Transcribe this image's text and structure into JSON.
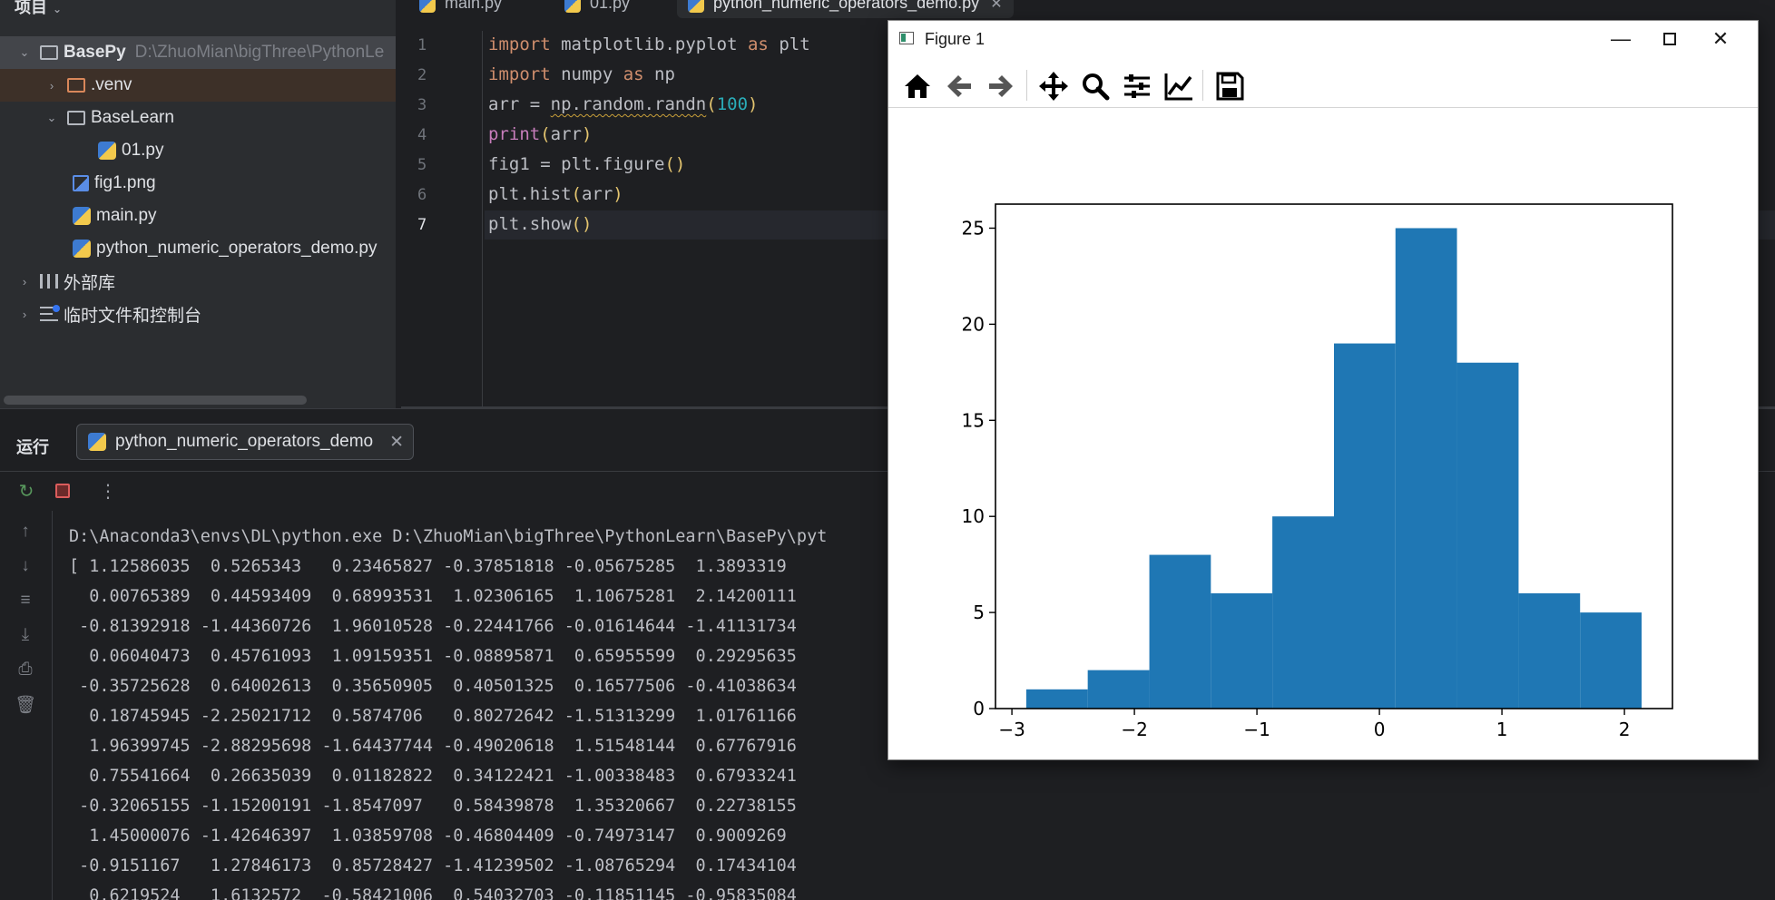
{
  "project": {
    "header": "项目",
    "items": [
      {
        "label": "BasePy",
        "path": "D:\\ZhuoMian\\bigThree\\PythonLe"
      },
      {
        "label": ".venv"
      },
      {
        "label": "BaseLearn"
      },
      {
        "label": "01.py"
      },
      {
        "label": "fig1.png"
      },
      {
        "label": "main.py"
      },
      {
        "label": "python_numeric_operators_demo.py"
      },
      {
        "label": "外部库"
      },
      {
        "label": "临时文件和控制台"
      }
    ]
  },
  "editor": {
    "tabs": [
      "main.py",
      "01.py",
      "python_numeric_operators_demo.py"
    ],
    "active_tab": 2,
    "line_numbers": [
      "1",
      "2",
      "3",
      "4",
      "5",
      "6",
      "7"
    ],
    "current_line": 7,
    "lines": [
      [
        {
          "t": "import",
          "c": "kw"
        },
        {
          "t": " matplotlib.pyplot ",
          "c": ""
        },
        {
          "t": "as",
          "c": "kw"
        },
        {
          "t": " plt",
          "c": ""
        }
      ],
      [
        {
          "t": "import",
          "c": "kw"
        },
        {
          "t": " numpy ",
          "c": ""
        },
        {
          "t": "as",
          "c": "kw"
        },
        {
          "t": " np",
          "c": ""
        }
      ],
      [
        {
          "t": "arr = ",
          "c": ""
        },
        {
          "t": "np.random.randn",
          "c": "squig"
        },
        {
          "t": "(",
          "c": "par"
        },
        {
          "t": "100",
          "c": "num"
        },
        {
          "t": ")",
          "c": "par"
        }
      ],
      [
        {
          "t": "print",
          "c": "fn"
        },
        {
          "t": "(",
          "c": "par"
        },
        {
          "t": "arr",
          "c": ""
        },
        {
          "t": ")",
          "c": "par"
        }
      ],
      [
        {
          "t": "fig1 = plt.figure",
          "c": ""
        },
        {
          "t": "()",
          "c": "par"
        }
      ],
      [
        {
          "t": "plt.hist",
          "c": ""
        },
        {
          "t": "(",
          "c": "par"
        },
        {
          "t": "arr",
          "c": ""
        },
        {
          "t": ")",
          "c": "par"
        }
      ],
      [
        {
          "t": "plt.show",
          "c": ""
        },
        {
          "t": "()",
          "c": "par"
        }
      ]
    ]
  },
  "run": {
    "title": "运行",
    "tab_label": "python_numeric_operators_demo",
    "console": [
      "D:\\Anaconda3\\envs\\DL\\python.exe D:\\ZhuoMian\\bigThree\\PythonLearn\\BasePy\\pyt",
      "[ 1.12586035  0.5265343   0.23465827 -0.37851818 -0.05675285  1.3893319",
      "  0.00765389  0.44593409  0.68993531  1.02306165  1.10675281  2.14200111",
      " -0.81392918 -1.44360726  1.96010528 -0.22441766 -0.01614644 -1.41131734",
      "  0.06040473  0.45761093  1.09159351 -0.08895871  0.65955599  0.29295635",
      " -0.35725628  0.64002613  0.35650905  0.40501325  0.16577506 -0.41038634",
      "  0.18745945 -2.25021712  0.5874706   0.80272642 -1.51313299  1.01761166",
      "  1.96399745 -2.88295698 -1.64437744 -0.49020618  1.51548144  0.67767916",
      "  0.75541664  0.26635039  0.01182822  0.34122421 -1.00338483  0.67933241",
      " -0.32065155 -1.15200191 -1.8547097   0.58439878  1.35320667  0.22738155",
      "  1.45000076 -1.42646397  1.03859708 -0.46804409 -0.74973147  0.9009269",
      " -0.9151167   1.27846173  0.85728427 -1.41239502 -1.08765294  0.17434104",
      "  0.6219524   1.6132572  -0.58421006  0.54032703 -0.11851145 -0.95835084"
    ]
  },
  "figure": {
    "title": "Figure 1",
    "toolbar": [
      "home-icon",
      "back-icon",
      "forward-icon",
      "pan-icon",
      "zoom-icon",
      "configure-subplots-icon",
      "edit-axis-icon",
      "save-icon"
    ],
    "bar_color": "#1f77b4"
  },
  "chart_data": {
    "type": "bar",
    "subtype": "histogram",
    "bin_edges": [
      -2.883,
      -2.381,
      -1.878,
      -1.376,
      -0.874,
      -0.371,
      0.131,
      0.633,
      1.136,
      1.638,
      2.14
    ],
    "values": [
      1,
      2,
      8,
      6,
      10,
      19,
      25,
      18,
      6,
      5
    ],
    "xlim": [
      -3.134,
      2.392
    ],
    "ylim": [
      0,
      26.25
    ],
    "xticks": [
      "−3",
      "−2",
      "−1",
      "0",
      "1",
      "2"
    ],
    "yticks": [
      "0",
      "5",
      "10",
      "15",
      "20",
      "25"
    ],
    "grid": false,
    "title": "",
    "xlabel": "",
    "ylabel": ""
  }
}
